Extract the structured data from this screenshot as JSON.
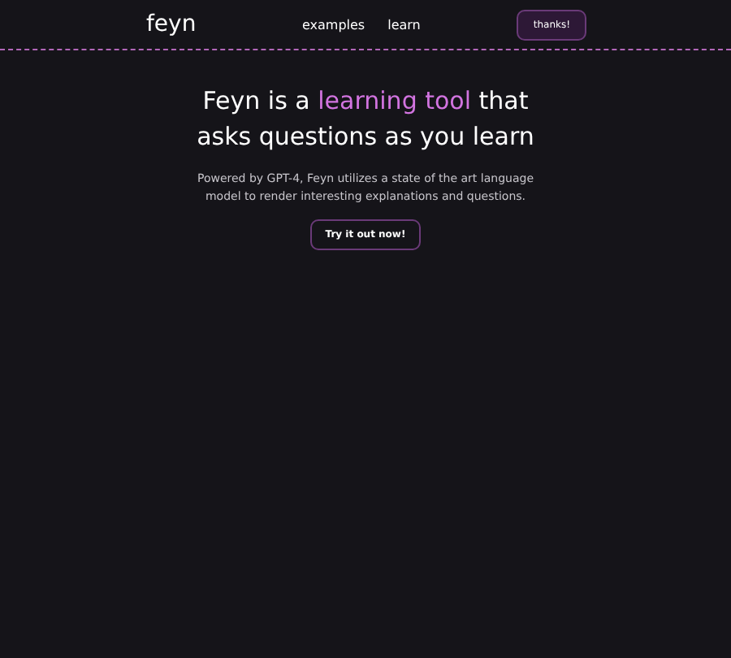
{
  "header": {
    "logo": "feyn",
    "nav": [
      "examples",
      "learn"
    ],
    "button": "thanks!"
  },
  "hero": {
    "title_before": "Feyn is a",
    "title_highlight": "learning tool",
    "title_after": "that asks questions as you learn",
    "description": "Powered by GPT-4, Feyn utilizes a state of the art language model to render interesting explanations and questions.",
    "cta": "Try it out now!"
  }
}
